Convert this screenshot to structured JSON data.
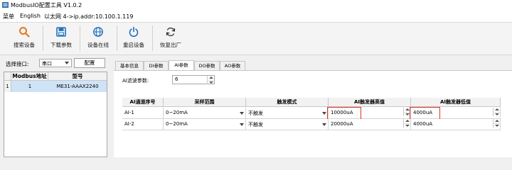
{
  "window": {
    "title": "ModbusIO配置工具 V1.0.2"
  },
  "menu": {
    "items": [
      "菜单",
      "English",
      "以太网 4->ip.addr:10.100.1.119"
    ]
  },
  "toolbar": {
    "buttons": [
      {
        "label": "搜索设备",
        "icon": "search-icon"
      },
      {
        "label": "下载参数",
        "icon": "save-icon"
      },
      {
        "label": "设备在线",
        "icon": "globe-icon"
      },
      {
        "label": "重启设备",
        "icon": "power-icon"
      },
      {
        "label": "恢复出厂",
        "icon": "refresh-icon"
      }
    ]
  },
  "connection": {
    "port_label": "选择接口:",
    "port_value": "串口",
    "config_button": "配置"
  },
  "device_table": {
    "columns": [
      "Modbus地址",
      "型号"
    ],
    "rows": [
      {
        "index": "1",
        "address": "1",
        "model": "ME31-AAAX2240"
      }
    ]
  },
  "tabs": [
    "基本信息",
    "DI参数",
    "AI参数",
    "DO参数",
    "AO参数"
  ],
  "active_tab": "AI参数",
  "filter": {
    "label": "AI滤波参数:",
    "value": "6"
  },
  "ai_grid": {
    "columns": [
      "AI通道序号",
      "采样范围",
      "触发模式",
      "AI触发器高值",
      "AI触发器低值"
    ],
    "rows": [
      {
        "channel": "AI-1",
        "range": "0~20mA",
        "mode": "不触发",
        "high": "10000uA",
        "low": "4000uA"
      },
      {
        "channel": "AI-2",
        "range": "0~20mA",
        "mode": "不触发",
        "high": "20000uA",
        "low": "4000uA"
      }
    ]
  },
  "colors": {
    "highlight": "#e0302a",
    "selected_row": "#cfe3f7",
    "accent": "#1f6fbf"
  }
}
